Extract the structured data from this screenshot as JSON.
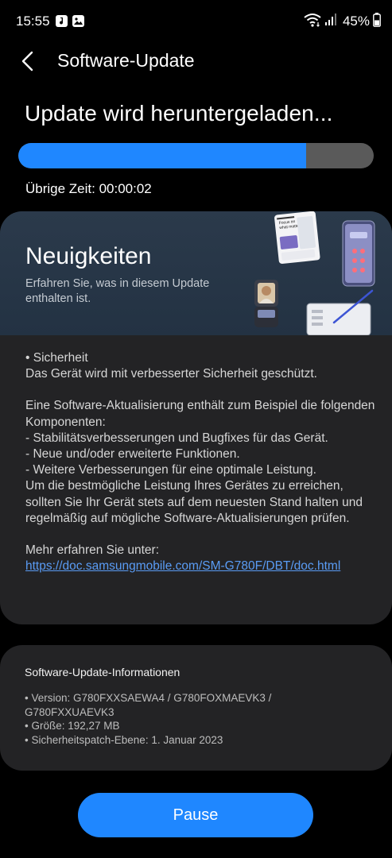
{
  "status_bar": {
    "time": "15:55",
    "battery": "45%",
    "icons": [
      "music-notification-icon",
      "image-notification-icon",
      "wifi-icon",
      "signal-icon",
      "battery-icon"
    ]
  },
  "header": {
    "title": "Software-Update",
    "back_icon": "back-arrow-icon"
  },
  "download": {
    "title": "Update wird heruntergeladen...",
    "progress_fraction": 0.81,
    "remaining_time": "Übrige Zeit: 00:00:02"
  },
  "news": {
    "title": "Neuigkeiten",
    "subtitle": "Erfahren Sie, was in diesem Update enthalten ist.",
    "illustration_text": [
      "Focus on",
      "what matters"
    ],
    "body": [
      "• Sicherheit",
      "Das Gerät wird mit verbesserter Sicherheit geschützt.",
      "",
      "Eine Software-Aktualisierung enthält zum Beispiel die folgenden Komponenten:",
      " - Stabilitätsverbesserungen und Bugfixes für das Gerät.",
      " - Neue und/oder erweiterte Funktionen.",
      " - Weitere Verbesserungen für eine optimale Leistung.",
      "Um die bestmögliche Leistung Ihres Gerätes zu erreichen, sollten Sie Ihr Gerät stets auf dem neuesten Stand halten und regelmäßig auf mögliche Software-Aktualisierungen prüfen.",
      "",
      "Mehr erfahren Sie unter:"
    ],
    "link": "https://doc.samsungmobile.com/SM-G780F/DBT/doc.html"
  },
  "info": {
    "title": "Software-Update-Informationen",
    "items": [
      "• Version: G780FXXSAEWA4 / G780FOXMAEVK3 / G780FXXUAEVK3",
      "• Größe: 192,27 MB",
      "• Sicherheitspatch-Ebene: 1. Januar 2023"
    ]
  },
  "actions": {
    "pause_label": "Pause"
  },
  "colors": {
    "accent": "#1f87ff",
    "progress_track": "#5a5a5a",
    "card_background": "#232325",
    "banner_background": "#2b3a4b",
    "link": "#5a9cf5"
  }
}
